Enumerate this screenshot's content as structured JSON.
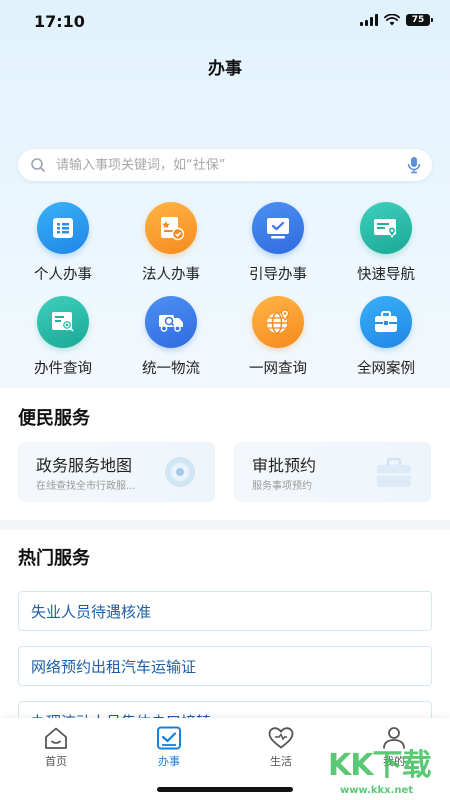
{
  "status_bar": {
    "time": "17:10",
    "battery": "75"
  },
  "header": {
    "title": "办事"
  },
  "search": {
    "placeholder": "请输入事项关键词，如“社保”"
  },
  "grid": [
    {
      "label": "个人办事",
      "icon": "list-icon",
      "color": "#2a9bef"
    },
    {
      "label": "法人办事",
      "icon": "enterprise-icon",
      "color": "#f89c2c"
    },
    {
      "label": "引导办事",
      "icon": "monitor-check-icon",
      "color": "#3c7ee9"
    },
    {
      "label": "快速导航",
      "icon": "map-pin-card-icon",
      "color": "#24b9a5"
    },
    {
      "label": "办件查询",
      "icon": "document-search-icon",
      "color": "#24b9a5"
    },
    {
      "label": "统一物流",
      "icon": "truck-icon",
      "color": "#3c7ee9"
    },
    {
      "label": "一网查询",
      "icon": "globe-pin-icon",
      "color": "#f89c2c"
    },
    {
      "label": "全网案例",
      "icon": "briefcase-icon",
      "color": "#2a9bef"
    }
  ],
  "convenience": {
    "title": "便民服务",
    "cards": [
      {
        "title": "政务服务地图",
        "subtitle": "在线查找全市行政服...",
        "icon": "map-target-icon"
      },
      {
        "title": "审批预约",
        "subtitle": "服务事项预约",
        "icon": "briefcase-icon"
      }
    ]
  },
  "hot": {
    "title": "热门服务",
    "items": [
      {
        "label": "失业人员待遇核准"
      },
      {
        "label": "网络预约出租汽车运输证"
      },
      {
        "label": "办理流动人员集体户口接转"
      }
    ]
  },
  "tabs": [
    {
      "label": "首页",
      "icon": "home-icon",
      "active": false
    },
    {
      "label": "办事",
      "icon": "checkbox-icon",
      "active": true
    },
    {
      "label": "生活",
      "icon": "heart-icon",
      "active": false
    },
    {
      "label": "我的",
      "icon": "user-icon",
      "active": false
    }
  ],
  "watermark": {
    "text": "KK下载",
    "url": "www.kkx.net"
  },
  "colors": {
    "accent": "#1a7fd8",
    "link": "#1d5fa8"
  }
}
